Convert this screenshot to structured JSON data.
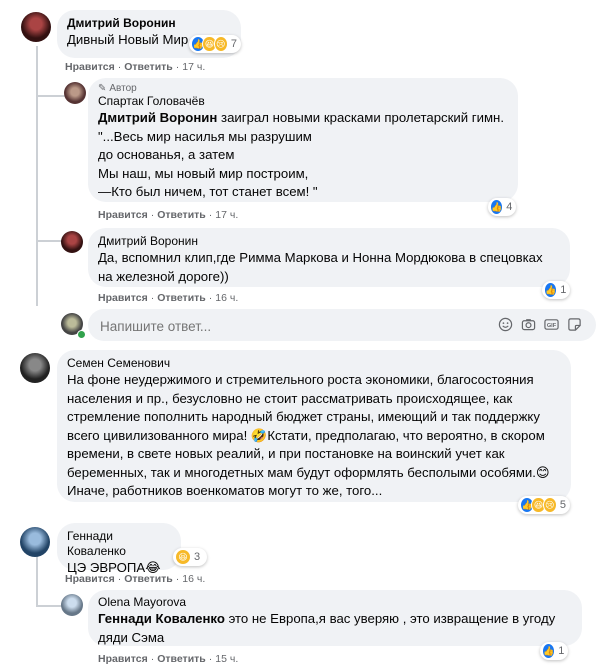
{
  "comments": [
    {
      "author": "Дмитрий Воронин",
      "text": "Дивный Новый Мир",
      "reaction_count": "7",
      "like_label": "Нравится",
      "reply_label": "Ответить",
      "time": "17 ч."
    },
    {
      "author_badge": "Автор",
      "author": "Спартак Головачёв",
      "mention": "Дмитрий Воронин",
      "text_after_mention": " заиграл новыми красками пролетарский гимн.",
      "lines": [
        "\"...Весь мир насилья мы разрушим",
        "до основанья, а затем",
        "Мы наш, мы новый мир построим,",
        "—Кто был ничем, тот станет всем! \""
      ],
      "reaction_count": "4",
      "like_label": "Нравится",
      "reply_label": "Ответить",
      "time": "17 ч."
    },
    {
      "author": "Дмитрий Воронин",
      "lines": [
        "Да, вспомнил клип,где Римма Маркова и Нонна Мордюкова в спецовках",
        "на железной дороге))"
      ],
      "reaction_count": "1",
      "like_label": "Нравится",
      "reply_label": "Ответить",
      "time": "16 ч."
    },
    {
      "author": "Семен Семенович",
      "lines": [
        "На фоне неудержимого и стремительного роста экономики, благосостояния",
        "населения и пр., безусловно не стоит рассматривать происходящее, как",
        "стремление пополнить народный бюджет страны, имеющий и так поддержку",
        "всего цивилизованного мира! 🤣Кстати, предполагаю, что вероятно, в скором",
        "времени, в свете новых реалий, и при постановке на воинский учет как",
        "беременных, так и многодетных мам будут оформлять бесполыми особями.😊",
        "Иначе, работников военкоматов могут то же, того..."
      ],
      "reaction_count": "5"
    },
    {
      "author": "Геннади Коваленко",
      "text": "ЦЭ ЭВРОПА😂",
      "reaction_count": "3",
      "like_label": "Нравится",
      "reply_label": "Ответить",
      "time": "16 ч."
    },
    {
      "author": "Olena Mayorova",
      "mention": "Геннади Коваленко",
      "text_after_mention": " это не Европа,я вас уверяю , это извращение в угоду",
      "line2": "дяди Сэма",
      "reaction_count": "1",
      "like_label": "Нравится",
      "reply_label": "Ответить",
      "time": "15 ч."
    }
  ],
  "reply_input": {
    "placeholder": "Напишите ответ..."
  },
  "icons": {
    "emoji": "smiley-icon",
    "camera": "camera-icon",
    "gif": "gif-icon",
    "sticker": "sticker-icon"
  },
  "colors": {
    "bubble": "#f0f2f5",
    "like_blue": "#1877f2",
    "meta_gray": "#65676b"
  }
}
